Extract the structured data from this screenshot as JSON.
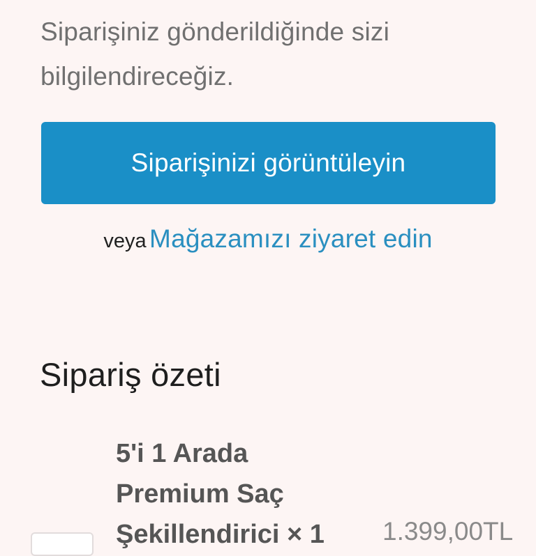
{
  "intro_message": "Siparişiniz gönderildiğinde sizi bilgilendireceğiz.",
  "view_order_button": "Siparişinizi görüntüleyin",
  "or_text": "veya",
  "visit_store_link": "Mağazamızı ziyaret edin",
  "summary": {
    "title": "Sipariş özeti",
    "items": [
      {
        "name": "5'i 1 Arada Premium Saç Şekillendirici",
        "quantity_text": "× 1",
        "price": "1.399,00TL"
      }
    ]
  },
  "colors": {
    "background": "#fdf5f4",
    "accent": "#1a8fc7",
    "link": "#2a8fc0"
  }
}
